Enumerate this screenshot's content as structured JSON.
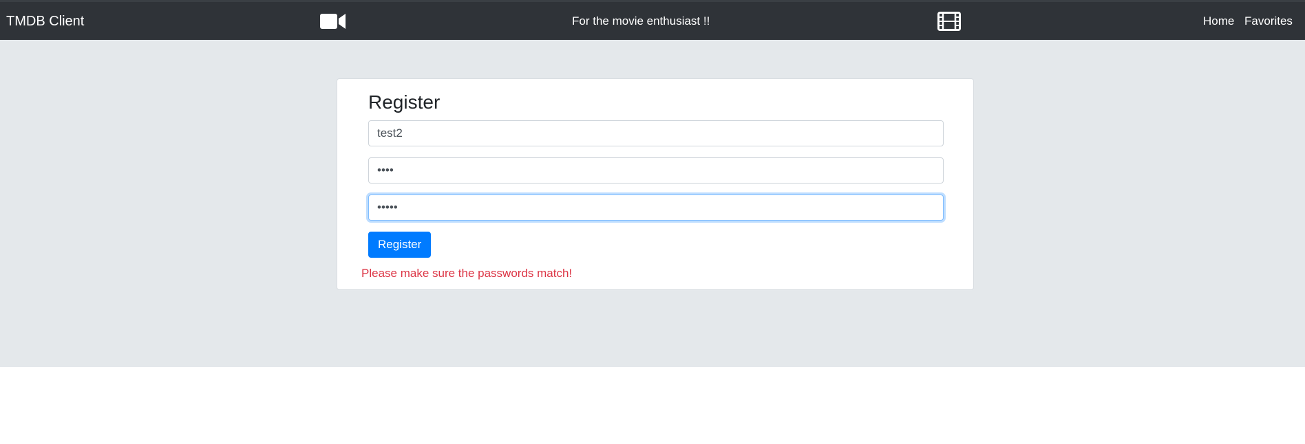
{
  "navbar": {
    "brand": "TMDB Client",
    "tagline": "For the movie enthusiast !!",
    "links": [
      {
        "label": "Home"
      },
      {
        "label": "Favorites"
      }
    ],
    "icons": [
      "video-camera-icon",
      "film-strip-icon"
    ],
    "background_color": "#2f3338"
  },
  "register_form": {
    "title": "Register",
    "username": {
      "value": "test2"
    },
    "password": {
      "value": "abcd"
    },
    "confirm_password": {
      "value": "abcde",
      "focused": true
    },
    "submit_label": "Register",
    "error_message": "Please make sure the passwords match!"
  },
  "colors": {
    "accent": "#007bff",
    "error": "#dc3545",
    "hero_background": "#e4e8eb"
  }
}
